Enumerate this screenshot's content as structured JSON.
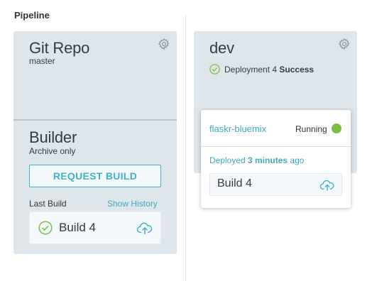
{
  "pipeline": {
    "label": "Pipeline"
  },
  "stages": [
    {
      "title": "Git Repo",
      "subtitle": "master"
    },
    {
      "title": "Builder",
      "subtitle": "Archive only",
      "request_button": "REQUEST BUILD",
      "last_build_label": "Last Build",
      "show_history_label": "Show History",
      "last_build": {
        "label": "Build 4",
        "status": "success"
      }
    },
    {
      "title": "dev",
      "deployment_text": "Deployment 4",
      "deployment_status": "Success",
      "popup": {
        "app_name": "flaskr-bluemix",
        "status_text": "Running",
        "deployed_prefix": "Deployed",
        "deployed_time": "3 minutes",
        "deployed_suffix": "ago",
        "build_label": "Build 4"
      }
    }
  ],
  "colors": {
    "accent": "#3fb3c9",
    "success": "#7cbd42",
    "card_bg": "#dfe6eb"
  },
  "icons": [
    "gear-icon",
    "check-circle-icon",
    "cloud-upload-icon",
    "status-dot-icon"
  ]
}
